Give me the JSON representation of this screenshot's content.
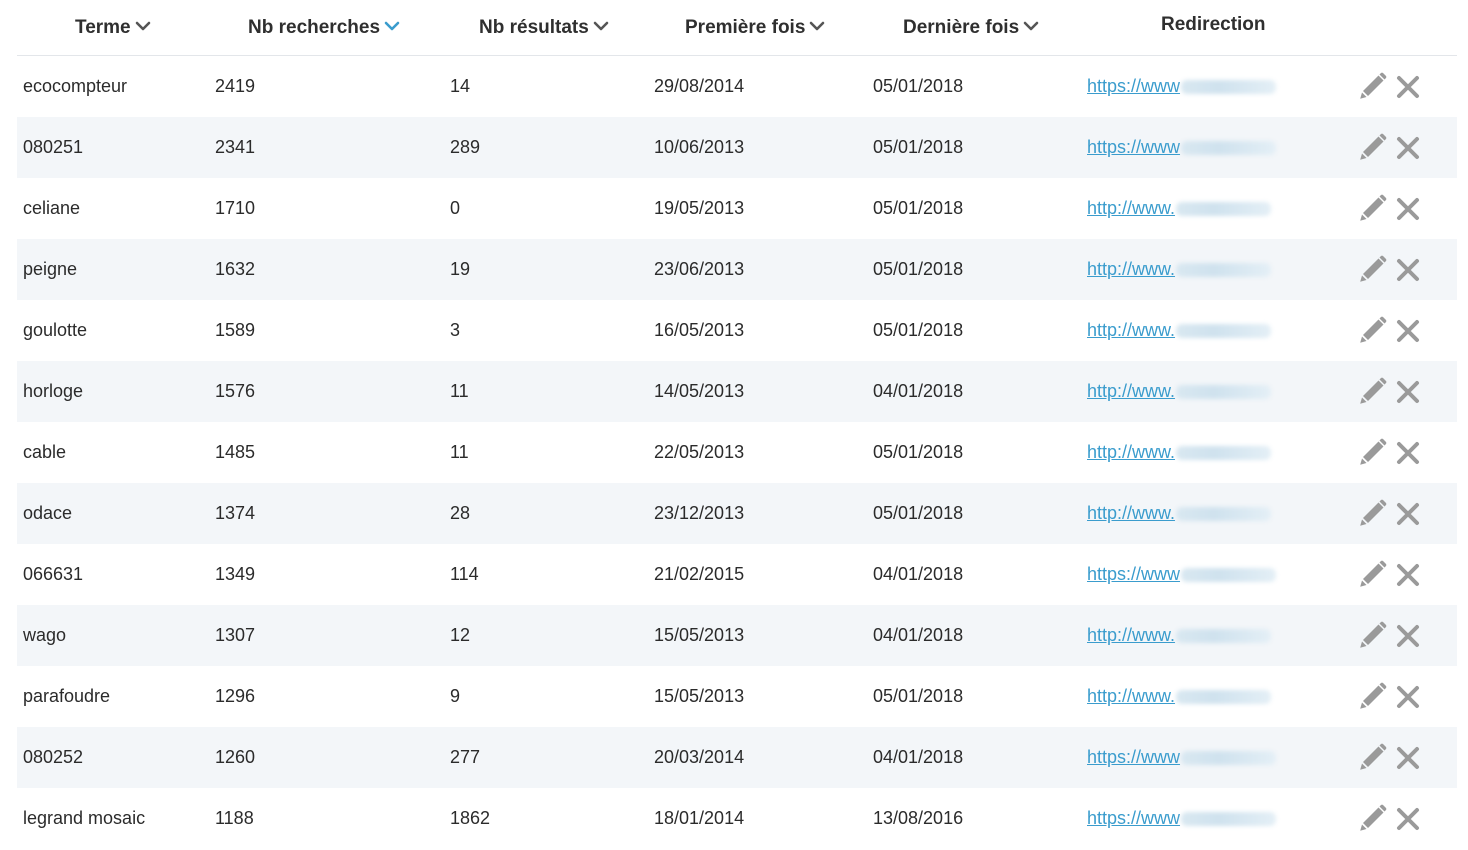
{
  "columns": [
    {
      "label": "Terme",
      "sort": "inactive"
    },
    {
      "label": "Nb recherches",
      "sort": "active"
    },
    {
      "label": "Nb résultats",
      "sort": "inactive"
    },
    {
      "label": "Première fois",
      "sort": "inactive"
    },
    {
      "label": "Dernière fois",
      "sort": "inactive"
    },
    {
      "label": "Redirection"
    }
  ],
  "colors": {
    "accent": "#3a9ccd",
    "row_alt": "#f3f6f9",
    "icon": "#9a9a9a",
    "sort_active": "#3a9ccd"
  },
  "rows": [
    {
      "terme": "ecocompteur",
      "recherches": "2419",
      "resultats": "14",
      "premiere": "29/08/2014",
      "derniere": "05/01/2018",
      "redirection": "https://www"
    },
    {
      "terme": "080251",
      "recherches": "2341",
      "resultats": "289",
      "premiere": "10/06/2013",
      "derniere": "05/01/2018",
      "redirection": "https://www"
    },
    {
      "terme": "celiane",
      "recherches": "1710",
      "resultats": "0",
      "premiere": "19/05/2013",
      "derniere": "05/01/2018",
      "redirection": "http://www."
    },
    {
      "terme": "peigne",
      "recherches": "1632",
      "resultats": "19",
      "premiere": "23/06/2013",
      "derniere": "05/01/2018",
      "redirection": "http://www."
    },
    {
      "terme": "goulotte",
      "recherches": "1589",
      "resultats": "3",
      "premiere": "16/05/2013",
      "derniere": "05/01/2018",
      "redirection": "http://www."
    },
    {
      "terme": "horloge",
      "recherches": "1576",
      "resultats": "11",
      "premiere": "14/05/2013",
      "derniere": "04/01/2018",
      "redirection": "http://www."
    },
    {
      "terme": "cable",
      "recherches": "1485",
      "resultats": "11",
      "premiere": "22/05/2013",
      "derniere": "05/01/2018",
      "redirection": "http://www."
    },
    {
      "terme": "odace",
      "recherches": "1374",
      "resultats": "28",
      "premiere": "23/12/2013",
      "derniere": "05/01/2018",
      "redirection": "http://www."
    },
    {
      "terme": "066631",
      "recherches": "1349",
      "resultats": "114",
      "premiere": "21/02/2015",
      "derniere": "04/01/2018",
      "redirection": "https://www"
    },
    {
      "terme": "wago",
      "recherches": "1307",
      "resultats": "12",
      "premiere": "15/05/2013",
      "derniere": "04/01/2018",
      "redirection": "http://www."
    },
    {
      "terme": "parafoudre",
      "recherches": "1296",
      "resultats": "9",
      "premiere": "15/05/2013",
      "derniere": "05/01/2018",
      "redirection": "http://www."
    },
    {
      "terme": "080252",
      "recherches": "1260",
      "resultats": "277",
      "premiere": "20/03/2014",
      "derniere": "04/01/2018",
      "redirection": "https://www"
    },
    {
      "terme": "legrand mosaic",
      "recherches": "1188",
      "resultats": "1862",
      "premiere": "18/01/2014",
      "derniere": "13/08/2016",
      "redirection": "https://www"
    }
  ]
}
